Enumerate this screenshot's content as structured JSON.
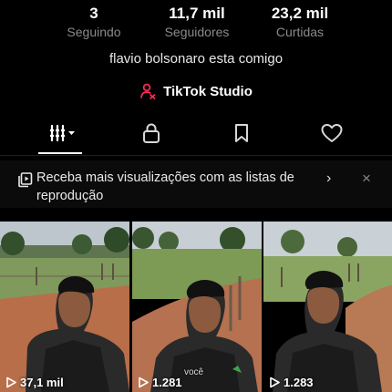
{
  "profile": {
    "stats": [
      {
        "value": "3",
        "label": "Seguindo"
      },
      {
        "value": "11,7 mil",
        "label": "Seguidores"
      },
      {
        "value": "23,2 mil",
        "label": "Curtidas"
      }
    ],
    "bio": "flavio bolsonaro esta comigo",
    "studio_label": "TikTok Studio"
  },
  "tabs": [
    {
      "icon": "videos-grid-icon",
      "selected": true
    },
    {
      "icon": "lock-icon",
      "selected": false
    },
    {
      "icon": "bookmark-icon",
      "selected": false
    },
    {
      "icon": "heart-icon",
      "selected": false
    }
  ],
  "banner": {
    "text": "Receba mais visualizações com as listas de reprodução",
    "icon": "playlist-icon",
    "chevron": "›",
    "close": "×"
  },
  "videos": [
    {
      "views": "37,1 mil"
    },
    {
      "views": "1.281",
      "caption": "você"
    },
    {
      "views": "1.283"
    }
  ],
  "colors": {
    "background": "#000000",
    "secondary_text": "#8a8a8a",
    "studio_icon": "#fe2c55"
  }
}
